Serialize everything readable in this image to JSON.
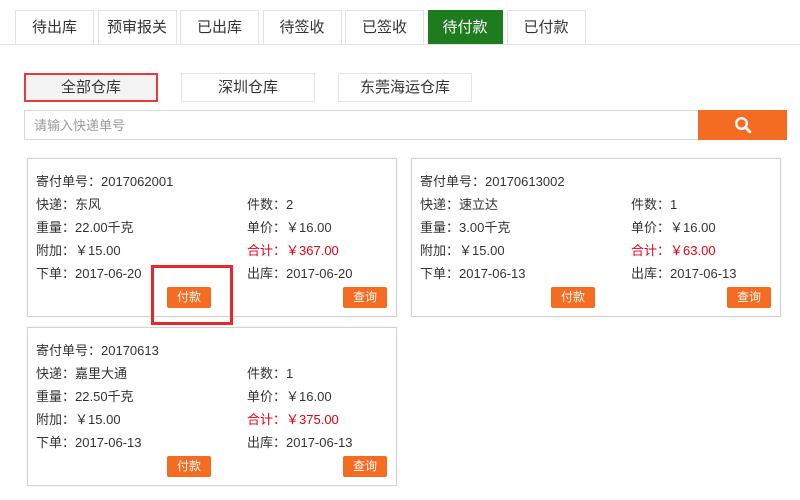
{
  "colors": {
    "active_tab": "#1e7b1e",
    "accent_orange": "#f36c21",
    "total_red": "#e60012",
    "selected_border": "#e83a3a",
    "highlight_red": "#e8262d"
  },
  "tabs": [
    {
      "label": "待出库",
      "active": false
    },
    {
      "label": "预审报关",
      "active": false
    },
    {
      "label": "已出库",
      "active": false
    },
    {
      "label": "待签收",
      "active": false
    },
    {
      "label": "已签收",
      "active": false
    },
    {
      "label": "待付款",
      "active": true
    },
    {
      "label": "已付款",
      "active": false
    }
  ],
  "warehouses": [
    {
      "label": "全部仓库",
      "selected": true
    },
    {
      "label": "深圳仓库",
      "selected": false
    },
    {
      "label": "东莞海运仓库",
      "selected": false
    }
  ],
  "search": {
    "placeholder": "请输入快递单号",
    "value": "",
    "button_icon": "search-icon"
  },
  "field_labels": {
    "order_no": "寄付单号：",
    "courier": "快递：",
    "pieces": "件数：",
    "weight": "重量：",
    "unit_price": "单价：",
    "surcharge": "附加：",
    "total": "合计：",
    "order_date": "下单：",
    "outbound_date": "出库："
  },
  "actions": {
    "pay": "付款",
    "query": "查询"
  },
  "orders": [
    {
      "order_no": "2017062001",
      "courier": "东风",
      "pieces": "2",
      "weight": "22.00千克",
      "unit_price": "￥16.00",
      "surcharge": "￥15.00",
      "total": "￥367.00",
      "order_date": "2017-06-20",
      "outbound_date": "2017-06-20"
    },
    {
      "order_no": "20170613002",
      "courier": "速立达",
      "pieces": "1",
      "weight": "3.00千克",
      "unit_price": "￥16.00",
      "surcharge": "￥15.00",
      "total": "￥63.00",
      "order_date": "2017-06-13",
      "outbound_date": "2017-06-13"
    },
    {
      "order_no": "20170613",
      "courier": "嘉里大通",
      "pieces": "1",
      "weight": "22.50千克",
      "unit_price": "￥16.00",
      "surcharge": "￥15.00",
      "total": "￥375.00",
      "order_date": "2017-06-13",
      "outbound_date": "2017-06-13"
    }
  ]
}
